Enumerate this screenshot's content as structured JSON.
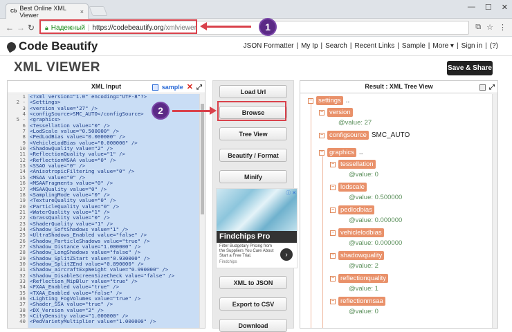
{
  "browser": {
    "tab_favicon": "Cb",
    "tab_title": "Best Online XML Viewer",
    "tab_close": "×",
    "secure_label": "Надежный",
    "url_host": "https://codebeautify.org",
    "url_path": "/xmlviewer",
    "win_min": "—",
    "win_max": "☐",
    "win_close": "✕"
  },
  "site": {
    "logo_text": "Code Beautify",
    "nav": [
      "JSON Formatter",
      "My Ip",
      "Search",
      "Recent Links",
      "Sample",
      "More ▾",
      "Sign in",
      "(?)"
    ],
    "page_title": "XML VIEWER",
    "save_share": "Save & Share"
  },
  "input_panel": {
    "title": "XML Input",
    "sample_label": "sample",
    "clear_icon": "✕",
    "fullscreen_icon": "⤢",
    "line_numbers": [
      "1",
      "2 -",
      "3",
      "4",
      "5 -",
      "6",
      "7",
      "8",
      "9",
      "10",
      "11",
      "12",
      "13",
      "14",
      "15",
      "16",
      "17",
      "18",
      "19",
      "20",
      "21",
      "22",
      "23",
      "24",
      "25",
      "26",
      "27",
      "28",
      "29",
      "30",
      "31",
      "32",
      "33",
      "34",
      "35",
      "36",
      "37",
      "38",
      "39",
      "40"
    ],
    "lines": [
      "<?xml version=\"1.0\" encoding=\"UTF-8\"?>",
      "<Settings>",
      "<version value=\"27\" />",
      "<configSource>SMC_AUTO</configSource>",
      "<graphics>",
      "<Tessellation value=\"0\" />",
      "<LodScale value=\"0.500000\" />",
      "<PedLodBias value=\"0.000000\" />",
      "<VehicleLodBias value=\"0.000000\" />",
      "<ShadowQuality value=\"2\" />",
      "<ReflectionQuality value=\"1\" />",
      "<ReflectionMSAA value=\"0\" />",
      "<SSAO value=\"0\" />",
      "<AnisotropicFiltering value=\"0\" />",
      "<MSAA value=\"0\" />",
      "<MSAAFragments value=\"0\" />",
      "<MSAAQuality value=\"0\" />",
      "<SamplingMode value=\"0\" />",
      "<TextureQuality value=\"0\" />",
      "<ParticleQuality value=\"0\" />",
      "<WaterQuality value=\"1\" />",
      "<GrassQuality value=\"0\" />",
      "<ShaderQuality value=\"1\" />",
      "<Shadow_SoftShadows value=\"1\" />",
      "<UltraShadows_Enabled value=\"false\" />",
      "<Shadow_ParticleShadows value=\"true\" />",
      "<Shadow_Distance value=\"1.000000\" />",
      "<Shadow_LongShadows value=\"false\" />",
      "<Shadow_SplitZStart value=\"0.930000\" />",
      "<Shadow_SplitZEnd value=\"0.890000\" />",
      "<Shadow_aircraftExpWeight value=\"0.990000\" />",
      "<Shadow_DisableScreenSizeCheck value=\"false\" />",
      "<Reflection_MipBlur value=\"true\" />",
      "<FXAA_Enabled value=\"true\" />",
      "<TXAA_Enabled value=\"false\" />",
      "<Lighting_FogVolumes value=\"true\" />",
      "<Shader_SSA value=\"true\" />",
      "<DX_Version value=\"2\" />",
      "<CityDensity value=\"1.000000\" />",
      "<PedVarietyMultiplier value=\"1.000000\" />"
    ]
  },
  "actions": {
    "load_url": "Load Url",
    "browse": "Browse",
    "tree_view": "Tree View",
    "beautify": "Beautify / Format",
    "minify": "Minify",
    "xml_to_json": "XML to JSON",
    "export_csv": "Export to CSV",
    "download": "Download"
  },
  "ad": {
    "tag": "ⓘ ✕",
    "title": "Findchips Pro",
    "text": "Filter Budgetary Pricing from the Suppliers You Care About Start a Free Trial.",
    "source": "Findchips",
    "go": "›"
  },
  "result_panel": {
    "title": "Result : XML Tree View",
    "fullscreen_icon": "⤢",
    "tree": {
      "root": "settings",
      "ellipsis": "..",
      "version": "version",
      "version_value": "@value:  27",
      "configsource": "configsource",
      "configsource_value": "SMC_AUTO",
      "graphics": "graphics",
      "tessellation": "tessellation",
      "tessellation_value": "@value:  0",
      "lodscale": "lodscale",
      "lodscale_value": "@value:  0.500000",
      "pedlodbias": "pedlodbias",
      "pedlodbias_value": "@value:  0.000000",
      "vehiclelodbias": "vehiclelodbias",
      "vehiclelodbias_value": "@value:  0.000000",
      "shadowquality": "shadowquality",
      "shadowquality_value": "@value:  2",
      "reflectionquality": "reflectionquality",
      "reflectionquality_value": "@value:  1",
      "reflectionmsaa": "reflectionmsaa",
      "reflectionmsaa_value": "@value:  0",
      "toggle": "−"
    }
  },
  "annotations": {
    "step1": "1",
    "step2": "2"
  }
}
